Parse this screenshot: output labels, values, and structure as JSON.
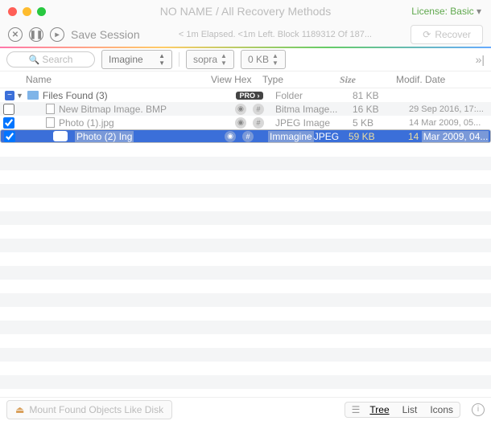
{
  "title": "NO NAME / All Recovery Methods",
  "license": "License: Basic",
  "toolbar": {
    "save": "Save Session",
    "status": "< 1m Elapsed. <1m Left. Block 1189312 Of 187...",
    "recover": "Recover"
  },
  "filter": {
    "search": "Search",
    "imagine": "Imagine",
    "sopra": "sopra",
    "size": "0 KB"
  },
  "cols": {
    "name": "Name",
    "view": "View Hex",
    "type": "Type",
    "size": "Size",
    "date": "Modif. Date"
  },
  "rows": [
    {
      "name": "Files Found (3)",
      "type": "Folder",
      "size": "81 KB",
      "date": ""
    },
    {
      "name": "New Bitmap Image. BMP",
      "type": "Bitma Image...",
      "size": "16 KB",
      "date": "29 Sep 2016, 17:..."
    },
    {
      "name": "Photo (1).jpg",
      "type": "JPEG Image",
      "size": "5 KB",
      "date": "14 Mar 2009, 05..."
    },
    {
      "name": "Photo (2) Ing",
      "type": "JPEG",
      "type_hl": "Immagine",
      "size": "59 KB",
      "date_pre": "14 ",
      "date": "Mar 2009, 04..."
    }
  ],
  "footer": {
    "mount": "Mount Found Objects Like Disk",
    "tree": "Tree",
    "list": "List",
    "icons": "Icons"
  }
}
